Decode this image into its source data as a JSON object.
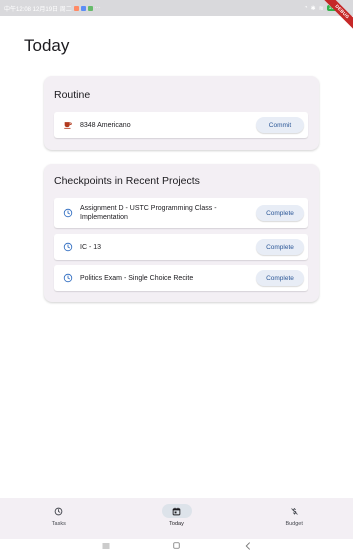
{
  "status_bar": {
    "time_date": "中午12:08 12月19日 周二",
    "dots": "···",
    "battery": "100"
  },
  "debug_banner": "DEBUG",
  "page": {
    "title": "Today"
  },
  "routine": {
    "title": "Routine",
    "items": [
      {
        "icon": "coffee-icon",
        "label": "8348 Americano",
        "action": "Commit"
      }
    ]
  },
  "checkpoints": {
    "title": "Checkpoints in Recent Projects",
    "items": [
      {
        "icon": "clock-icon",
        "label": "Assignment D - USTC Programming Class - Implementation",
        "action": "Complete"
      },
      {
        "icon": "clock-icon",
        "label": "IC - 13",
        "action": "Complete"
      },
      {
        "icon": "clock-icon",
        "label": "Politics Exam - Single Choice Recite",
        "action": "Complete"
      }
    ]
  },
  "bottom_nav": {
    "tabs": [
      {
        "label": "Tasks",
        "icon": "clock-icon"
      },
      {
        "label": "Today",
        "icon": "calendar-today-icon",
        "active": true
      },
      {
        "label": "Budget",
        "icon": "money-off-icon"
      }
    ]
  },
  "colors": {
    "accent": "#2b5797",
    "card_bg": "#f3eff4",
    "button_bg": "#e8edf6",
    "clock_icon": "#3a74c4"
  }
}
